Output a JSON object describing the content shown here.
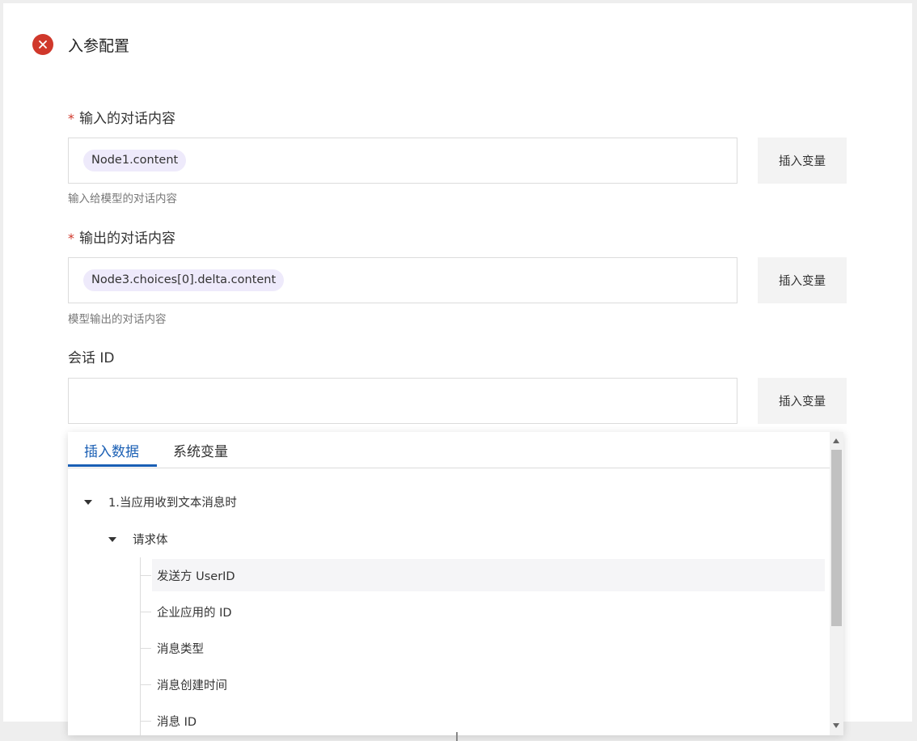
{
  "section": {
    "title": "入参配置",
    "status_icon": "error-circle-icon",
    "status_color": "#d0382b"
  },
  "fields": {
    "input_content": {
      "label": "输入的对话内容",
      "required_mark": "*",
      "chip": "Node1.content",
      "hint": "输入给模型的对话内容",
      "button": "插入变量"
    },
    "output_content": {
      "label": "输出的对话内容",
      "required_mark": "*",
      "chip": "Node3.choices[0].delta.content",
      "hint": "模型输出的对话内容",
      "button": "插入变量"
    },
    "session_id": {
      "label": "会话 ID",
      "value": "",
      "button": "插入变量"
    }
  },
  "dropdown": {
    "tabs": [
      "插入数据",
      "系统变量"
    ],
    "active_tab": 0,
    "accent_color": "#1a5fb4",
    "tree": {
      "root": "1.当应用收到文本消息时",
      "child": "请求体",
      "leaves": [
        "发送方 UserID",
        "企业应用的 ID",
        "消息类型",
        "消息创建时间",
        "消息 ID"
      ]
    }
  }
}
